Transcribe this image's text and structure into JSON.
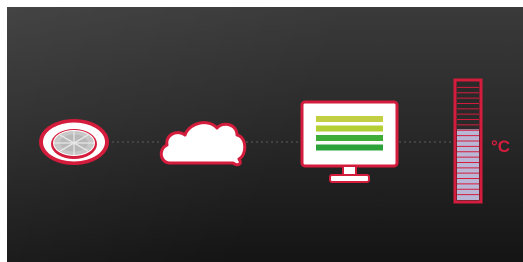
{
  "diagram": {
    "nodes": [
      {
        "id": "sensor",
        "icon": "ceiling-sensor-icon"
      },
      {
        "id": "cloud",
        "icon": "cloud-icon"
      },
      {
        "id": "monitor",
        "icon": "monitor-icon"
      },
      {
        "id": "thermometer",
        "icon": "thermometer-icon"
      }
    ],
    "connectors": [
      {
        "from": "sensor",
        "to": "cloud",
        "style": "dashed"
      },
      {
        "from": "cloud",
        "to": "monitor",
        "style": "dashed"
      },
      {
        "from": "monitor",
        "to": "thermometer",
        "style": "dashed"
      }
    ],
    "thermometer": {
      "unit_label": "°C",
      "level": 0.6
    },
    "monitor_bars": [
      "#c2cf43",
      "#b4cf34",
      "#3fae38",
      "#2ba33a"
    ],
    "colors": {
      "accent": "#d41c3c",
      "icon_fill": "#ffffff",
      "thermo_fill": "#b9b6d6",
      "connector": "#5c5c5c"
    }
  }
}
